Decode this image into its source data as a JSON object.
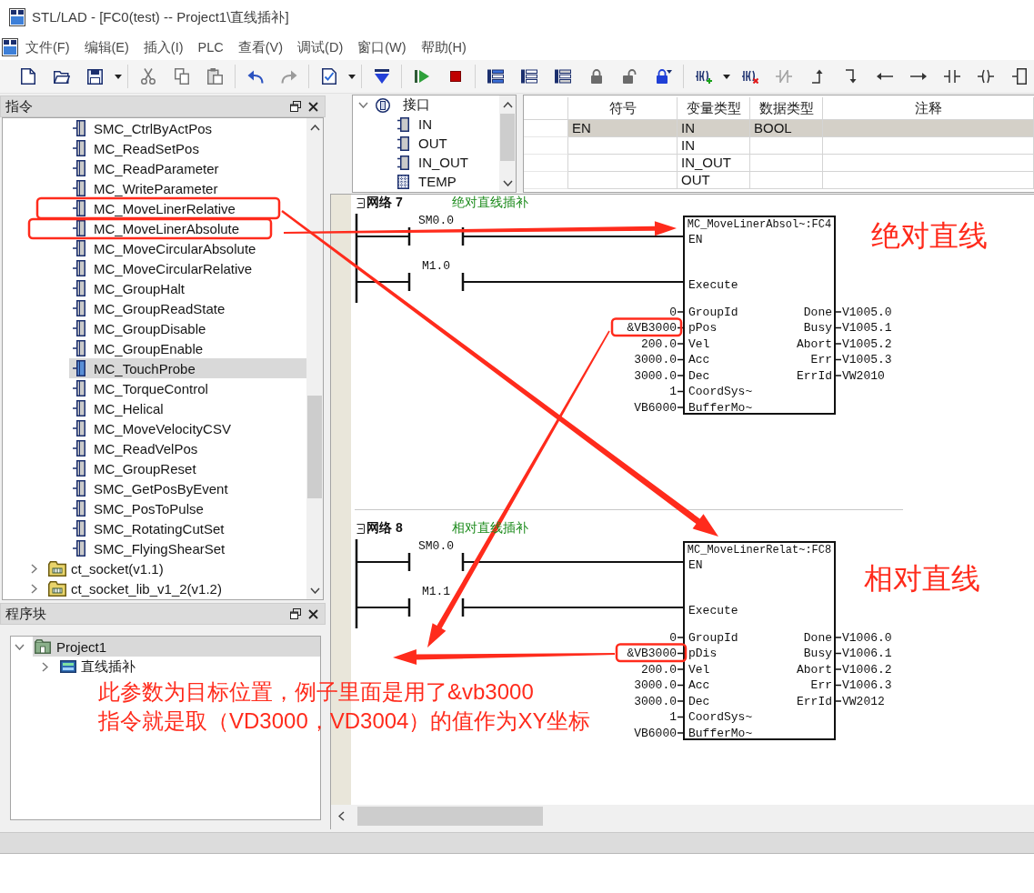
{
  "window": {
    "title": "STL/LAD - [FC0(test) -- Project1\\直线插补]"
  },
  "menu": [
    "文件(F)",
    "编辑(E)",
    "插入(I)",
    "PLC",
    "查看(V)",
    "调试(D)",
    "窗口(W)",
    "帮助(H)"
  ],
  "instructions_panel": {
    "title": "指令",
    "items": [
      {
        "kind": "instruction",
        "label": "SMC_CtrlByActPos",
        "selected": false
      },
      {
        "kind": "instruction",
        "label": "MC_ReadSetPos",
        "selected": false
      },
      {
        "kind": "instruction",
        "label": "MC_ReadParameter",
        "selected": false
      },
      {
        "kind": "instruction",
        "label": "MC_WriteParameter",
        "selected": false
      },
      {
        "kind": "instruction",
        "label": "MC_MoveLinerRelative",
        "selected": false
      },
      {
        "kind": "instruction",
        "label": "MC_MoveLinerAbsolute",
        "selected": false
      },
      {
        "kind": "instruction",
        "label": "MC_MoveCircularAbsolute",
        "selected": false
      },
      {
        "kind": "instruction",
        "label": "MC_MoveCircularRelative",
        "selected": false
      },
      {
        "kind": "instruction",
        "label": "MC_GroupHalt",
        "selected": false
      },
      {
        "kind": "instruction",
        "label": "MC_GroupReadState",
        "selected": false
      },
      {
        "kind": "instruction",
        "label": "MC_GroupDisable",
        "selected": false
      },
      {
        "kind": "instruction",
        "label": "MC_GroupEnable",
        "selected": false
      },
      {
        "kind": "instruction",
        "label": "MC_TouchProbe",
        "selected": true
      },
      {
        "kind": "instruction",
        "label": "MC_TorqueControl",
        "selected": false
      },
      {
        "kind": "instruction",
        "label": "MC_Helical",
        "selected": false
      },
      {
        "kind": "instruction",
        "label": "MC_MoveVelocityCSV",
        "selected": false
      },
      {
        "kind": "instruction",
        "label": "MC_ReadVelPos",
        "selected": false
      },
      {
        "kind": "instruction",
        "label": "MC_GroupReset",
        "selected": false
      },
      {
        "kind": "instruction",
        "label": "SMC_GetPosByEvent",
        "selected": false
      },
      {
        "kind": "instruction",
        "label": "SMC_PosToPulse",
        "selected": false
      },
      {
        "kind": "instruction",
        "label": "SMC_RotatingCutSet",
        "selected": false
      },
      {
        "kind": "instruction",
        "label": "SMC_FlyingShearSet",
        "selected": false
      },
      {
        "kind": "library",
        "label": "ct_socket(v1.1)",
        "expanded": false,
        "selected": false
      },
      {
        "kind": "library",
        "label": "ct_socket_lib_v1_2(v1.2)",
        "expanded": false,
        "selected": false
      }
    ]
  },
  "program_blocks_panel": {
    "title": "程序块",
    "tree": [
      {
        "kind": "project",
        "label": "Project1",
        "expanded": true,
        "selected": true,
        "children": [
          {
            "kind": "program",
            "label": "直线插补",
            "expanded": false,
            "selected": false
          }
        ]
      }
    ]
  },
  "interface_tree": [
    {
      "kind": "interface",
      "label": "接口",
      "expanded": true,
      "selected": false,
      "children": [
        {
          "kind": "pin",
          "label": "IN",
          "selected": false
        },
        {
          "kind": "pin",
          "label": "OUT",
          "selected": false
        },
        {
          "kind": "pin",
          "label": "IN_OUT",
          "selected": false
        },
        {
          "kind": "temp",
          "label": "TEMP",
          "selected": false
        }
      ]
    }
  ],
  "interface_table": {
    "columns": [
      "符号",
      "变量类型",
      "数据类型",
      "注释"
    ],
    "rows": [
      {
        "symbol": "EN",
        "variable_type": "IN",
        "data_type": "BOOL",
        "selected": true
      },
      {
        "variable_type": "IN",
        "selected": false
      },
      {
        "variable_type": "IN_OUT",
        "selected": false
      },
      {
        "variable_type": "OUT",
        "selected": false
      }
    ]
  },
  "networks": [
    {
      "title": "网络 7",
      "comment": "绝对直线插补",
      "contacts": [
        "SM0.0",
        "M1.0"
      ],
      "block": {
        "title": "MC_MoveLinerAbsol~:FC4",
        "enable_pins": [
          "EN",
          "Execute"
        ],
        "inputs": [
          {
            "name": "GroupId",
            "value": "0"
          },
          {
            "name": "pPos",
            "value": "&VB3000"
          },
          {
            "name": "Vel",
            "value": "200.0"
          },
          {
            "name": "Acc",
            "value": "3000.0"
          },
          {
            "name": "Dec",
            "value": "3000.0"
          },
          {
            "name": "CoordSys~",
            "value": "1"
          },
          {
            "name": "BufferMo~",
            "value": "VB6000"
          }
        ],
        "outputs": [
          {
            "name": "Done",
            "value": "V1005.0"
          },
          {
            "name": "Busy",
            "value": "V1005.1"
          },
          {
            "name": "Abort",
            "value": "V1005.2"
          },
          {
            "name": "Err",
            "value": "V1005.3"
          },
          {
            "name": "ErrId",
            "value": "VW2010"
          }
        ]
      }
    },
    {
      "title": "网络 8",
      "comment": "相对直线插补",
      "contacts": [
        "SM0.0",
        "M1.1"
      ],
      "block": {
        "title": "MC_MoveLinerRelat~:FC8",
        "enable_pins": [
          "EN",
          "Execute"
        ],
        "inputs": [
          {
            "name": "GroupId",
            "value": "0"
          },
          {
            "name": "pDis",
            "value": "&VB3000"
          },
          {
            "name": "Vel",
            "value": "200.0"
          },
          {
            "name": "Acc",
            "value": "3000.0"
          },
          {
            "name": "Dec",
            "value": "3000.0"
          },
          {
            "name": "CoordSys~",
            "value": "1"
          },
          {
            "name": "BufferMo~",
            "value": "VB6000"
          }
        ],
        "outputs": [
          {
            "name": "Done",
            "value": "V1006.0"
          },
          {
            "name": "Busy",
            "value": "V1006.1"
          },
          {
            "name": "Abort",
            "value": "V1006.2"
          },
          {
            "name": "Err",
            "value": "V1006.3"
          },
          {
            "name": "ErrId",
            "value": "VW2012"
          }
        ]
      }
    }
  ],
  "annotations": {
    "labels": [
      "绝对直线",
      "相对直线"
    ],
    "note": [
      "此参数为目标位置，例子里面是用了&vb3000",
      "指令就是取（VD3000，VD3004）的值作为XY坐标"
    ]
  }
}
